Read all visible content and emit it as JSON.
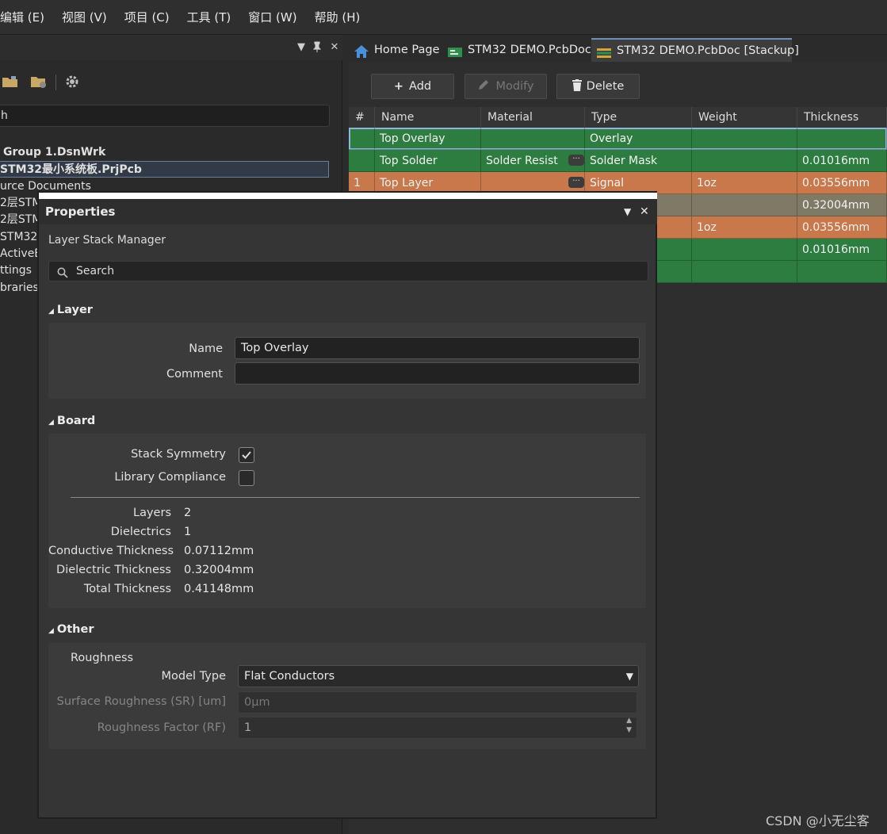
{
  "menu": [
    "编辑 (E)",
    "视图 (V)",
    "项目 (C)",
    "工具 (T)",
    "窗口 (W)",
    "帮助 (H)"
  ],
  "left_panel": {
    "header_controls": {
      "dropdown": "▼",
      "pin": "📌",
      "close": "✕"
    },
    "search_text": "h",
    "tree": [
      {
        "label": "Group 1.DsnWrk",
        "bold": true
      },
      {
        "label": "STM32最小系统板.PrjPcb",
        "bold": true,
        "selected": true
      },
      {
        "label": "urce Documents"
      },
      {
        "label": "2层STM"
      },
      {
        "label": "2层STM"
      },
      {
        "label": "STM32"
      },
      {
        "label": "ActiveB"
      },
      {
        "label": "ttings"
      },
      {
        "label": "braries"
      }
    ]
  },
  "tabs": [
    {
      "label": "Home Page",
      "icon": "home-icon"
    },
    {
      "label": "STM32 DEMO.PcbDoc",
      "icon": "pcb-icon"
    },
    {
      "label": "STM32 DEMO.PcbDoc [Stackup]",
      "icon": "stackup-icon",
      "active": true
    }
  ],
  "editor": {
    "add_label": "Add",
    "modify_label": "Modify",
    "delete_label": "Delete",
    "columns": [
      "#",
      "Name",
      "Material",
      "Type",
      "Weight",
      "Thickness"
    ],
    "rows": [
      {
        "num": "",
        "name": "Top Overlay",
        "material": "",
        "type": "Overlay",
        "weight": "",
        "thickness": "",
        "color": "#2e7d40",
        "selected": true
      },
      {
        "num": "",
        "name": "Top Solder",
        "material": "Solder Resist",
        "type": "Solder Mask",
        "weight": "",
        "thickness": "0.01016mm",
        "color": "#2e7d40",
        "dots": true
      },
      {
        "num": "1",
        "name": "Top Layer",
        "material": "",
        "type": "Signal",
        "weight": "1oz",
        "thickness": "0.03556mm",
        "color": "#c8784a",
        "dots": true
      },
      {
        "num": "",
        "name": "",
        "material": "",
        "type": "",
        "weight": "",
        "thickness": "0.32004mm",
        "color": "#7f7a66"
      },
      {
        "num": "",
        "name": "",
        "material": "",
        "type": "",
        "weight": "1oz",
        "thickness": "0.03556mm",
        "color": "#c8784a"
      },
      {
        "num": "",
        "name": "",
        "material": "",
        "type": "",
        "weight": "",
        "thickness": "0.01016mm",
        "color": "#2e7d40"
      },
      {
        "num": "",
        "name": "",
        "material": "",
        "type": "",
        "weight": "",
        "thickness": "",
        "color": "#2e7d40"
      }
    ]
  },
  "properties": {
    "title": "Properties",
    "subtitle": "Layer Stack Manager",
    "search_placeholder": "Search",
    "layer_section": "Layer",
    "name_label": "Name",
    "name_value": "Top Overlay",
    "comment_label": "Comment",
    "comment_value": "",
    "board_section": "Board",
    "stack_symmetry_label": "Stack Symmetry",
    "stack_symmetry_checked": true,
    "library_compliance_label": "Library Compliance",
    "library_compliance_checked": false,
    "stats": [
      {
        "label": "Layers",
        "value": "2"
      },
      {
        "label": "Dielectrics",
        "value": "1"
      },
      {
        "label": "Conductive Thickness",
        "value": "0.07112mm"
      },
      {
        "label": "Dielectric Thickness",
        "value": "0.32004mm"
      },
      {
        "label": "Total Thickness",
        "value": "0.41148mm"
      }
    ],
    "other_section": "Other",
    "roughness_label": "Roughness",
    "model_type_label": "Model Type",
    "model_type_value": "Flat Conductors",
    "surface_roughness_label": "Surface Roughness (SR) [um]",
    "surface_roughness_value": "0μm",
    "roughness_factor_label": "Roughness Factor (RF)",
    "roughness_factor_value": "1"
  },
  "watermark": "CSDN @小无尘客",
  "colors": {
    "accent": "#6d8fb8",
    "overlay": "#2e7d40",
    "signal": "#c8784a",
    "dielectric": "#7f7a66"
  }
}
